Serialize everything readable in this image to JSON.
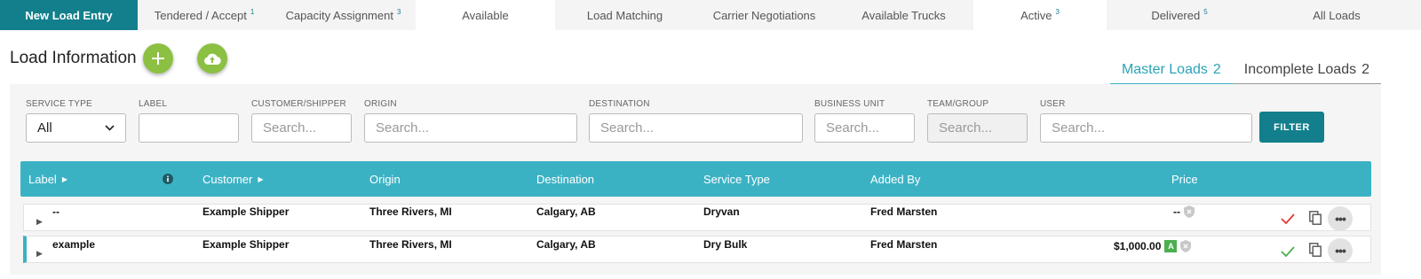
{
  "tabs": [
    {
      "label": "New Load Entry",
      "count": ""
    },
    {
      "label": "Tendered / Accept",
      "count": "1"
    },
    {
      "label": "Capacity Assignment",
      "count": "3"
    },
    {
      "label": "Available",
      "count": ""
    },
    {
      "label": "Load Matching",
      "count": ""
    },
    {
      "label": "Carrier Negotiations",
      "count": ""
    },
    {
      "label": "Available Trucks",
      "count": ""
    },
    {
      "label": "Active",
      "count": "3"
    },
    {
      "label": "Delivered",
      "count": "5"
    },
    {
      "label": "All Loads",
      "count": ""
    }
  ],
  "page": {
    "title": "Load Information",
    "add_icon": "plus-icon",
    "upload_icon": "cloud-upload-icon"
  },
  "subtabs": [
    {
      "label": "Master Loads",
      "count": "2"
    },
    {
      "label": "Incomplete Loads",
      "count": "2"
    }
  ],
  "filters": {
    "service_type": {
      "label": "SERVICE TYPE",
      "value": "All"
    },
    "label": {
      "label": "LABEL",
      "value": ""
    },
    "customer": {
      "label": "CUSTOMER/SHIPPER",
      "placeholder": "Search..."
    },
    "origin": {
      "label": "ORIGIN",
      "placeholder": "Search..."
    },
    "destination": {
      "label": "DESTINATION",
      "placeholder": "Search..."
    },
    "business_unit": {
      "label": "BUSINESS UNIT",
      "placeholder": "Search..."
    },
    "team": {
      "label": "TEAM/GROUP",
      "placeholder": "Search..."
    },
    "user": {
      "label": "USER",
      "placeholder": "Search..."
    },
    "button": "FILTER"
  },
  "table": {
    "columns": {
      "label": "Label",
      "customer": "Customer",
      "origin": "Origin",
      "destination": "Destination",
      "service_type": "Service Type",
      "added_by": "Added By",
      "price": "Price"
    },
    "rows": [
      {
        "label": "--",
        "customer": "Example Shipper",
        "origin": "Three Rivers, MI",
        "destination": "Calgary, AB",
        "service_type": "Dryvan",
        "added_by": "Fred Marsten",
        "price": "--",
        "badge": "",
        "check_color": "#e53935",
        "more": "•••"
      },
      {
        "label": "example",
        "customer": "Example Shipper",
        "origin": "Three Rivers, MI",
        "destination": "Calgary, AB",
        "service_type": "Dry Bulk",
        "added_by": "Fred Marsten",
        "price": "$1,000.00",
        "badge": "A",
        "check_color": "#4caf50",
        "more": "•••"
      }
    ]
  },
  "colors": {
    "teal_dark": "#137f8c",
    "teal": "#3bb2c4",
    "green": "#8cc043"
  }
}
